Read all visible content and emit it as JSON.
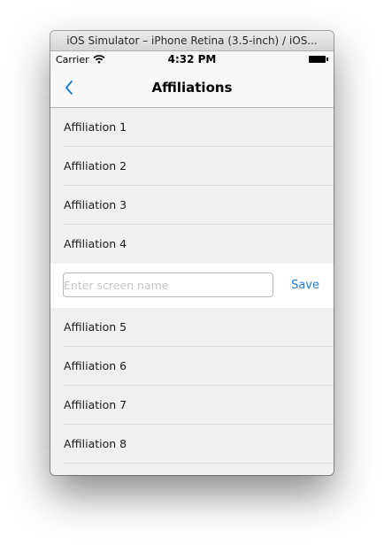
{
  "window": {
    "title": "iOS Simulator – iPhone Retina (3.5-inch) / iOS..."
  },
  "status_bar": {
    "carrier": "Carrier",
    "time": "4:32 PM",
    "wifi_icon": "wifi-icon",
    "battery_icon": "battery-icon"
  },
  "nav": {
    "title": "Affiliations",
    "back_icon": "chevron-left-icon"
  },
  "colors": {
    "tint": "#1d7fd1",
    "background": "#f1f0f0",
    "separator": "#dcdcdc"
  },
  "list": {
    "items_top": [
      {
        "label": "Affiliation 1"
      },
      {
        "label": "Affiliation 2"
      },
      {
        "label": "Affiliation 3"
      },
      {
        "label": "Affiliation 4"
      }
    ],
    "edit_row": {
      "value": "",
      "placeholder": "Enter screen name",
      "save_label": "Save"
    },
    "items_bottom": [
      {
        "label": "Affiliation 5"
      },
      {
        "label": "Affiliation 6"
      },
      {
        "label": "Affiliation 7"
      },
      {
        "label": "Affiliation 8"
      }
    ]
  }
}
